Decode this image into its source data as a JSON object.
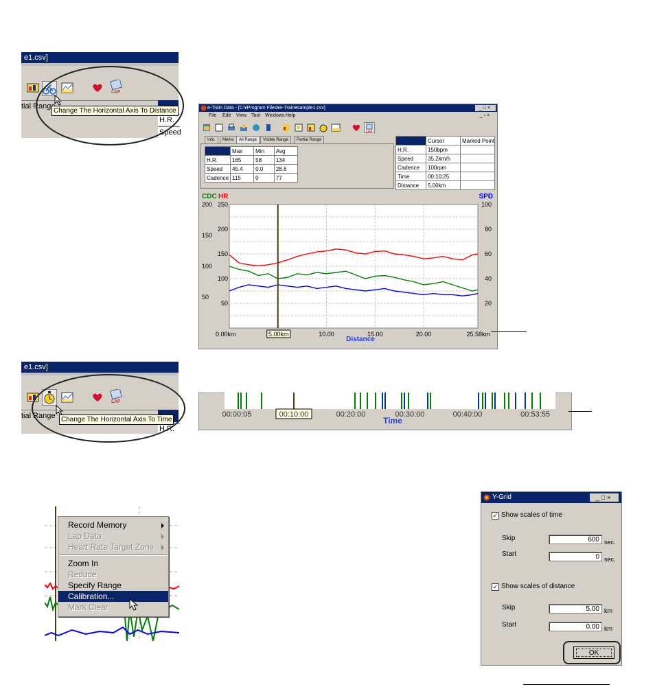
{
  "snip1": {
    "title_fragment": "e1.csv]",
    "tooltip": "Change The Horizontal Axis To Distance",
    "tab_fragment": "tial Range",
    "row_labels": [
      "H.R.",
      "Speed"
    ]
  },
  "snip2": {
    "title_fragment": "e1.csv]",
    "tooltip": "Change The Horizontal Axis To Time",
    "tab_fragment": "tial Range",
    "row_label": "H.R."
  },
  "main_window": {
    "title": "e-Train Data - [C:¥Program Files¥e-Train¥sample1.csv]",
    "menu": [
      "File",
      "Edit",
      "View",
      "Tool",
      "Windows",
      "Help"
    ],
    "tabs": [
      "Info.",
      "Memo",
      "All Range",
      "Visible Range",
      "Partial Range"
    ],
    "stats_headers": [
      "",
      "Max",
      "Min",
      "Avg"
    ],
    "stats_rows": [
      [
        "H.R.",
        "165",
        "58",
        "134"
      ],
      [
        "Speed",
        "45.4",
        "0.0",
        "28.6"
      ],
      [
        "Cadence",
        "115",
        "0",
        "77"
      ]
    ],
    "cursor_headers": [
      "",
      "Cursor",
      "Marked Point"
    ],
    "cursor_rows": [
      [
        "H.R.",
        "150bpm",
        ""
      ],
      [
        "Speed",
        "35.2km/h",
        ""
      ],
      [
        "Cadence",
        "100rpm",
        ""
      ],
      [
        "Time",
        "00:10:25",
        ""
      ],
      [
        "Distance",
        "5.00km",
        ""
      ]
    ]
  },
  "chart_data": {
    "type": "line",
    "xlabel": "Distance",
    "x_ticks": [
      "0.00km",
      "10.00",
      "15.00",
      "20.00",
      "25.58km"
    ],
    "cursor_label": "5.00km",
    "xlim": [
      0,
      25.58
    ],
    "legend": [
      {
        "label": "CDC",
        "color": "#008000"
      },
      {
        "label": "HR",
        "color": "#ff0000"
      },
      {
        "label": "SPD",
        "color": "#0000ff"
      }
    ],
    "axes": {
      "cdc": {
        "ticks": [
          "200",
          "150",
          "100",
          "50"
        ],
        "ylim": [
          0,
          200
        ]
      },
      "hr": {
        "ticks": [
          "250",
          "200",
          "150",
          "100",
          "50"
        ],
        "ylim": [
          0,
          250
        ]
      },
      "spd": {
        "ticks": [
          "100",
          "80",
          "60",
          "40",
          "20"
        ],
        "ylim": [
          0,
          100
        ]
      }
    },
    "grid": true,
    "cursor_x": 5.0,
    "series": [
      {
        "name": "HR",
        "color": "#ff0000",
        "x": [
          0,
          1,
          2,
          3,
          4,
          5,
          6,
          7,
          8,
          9,
          10,
          11,
          12,
          13,
          14,
          15,
          16,
          17,
          18,
          19,
          20,
          21,
          22,
          23,
          24,
          25,
          25.58
        ],
        "values": [
          148,
          132,
          128,
          126,
          128,
          132,
          138,
          145,
          150,
          154,
          156,
          160,
          158,
          152,
          150,
          155,
          156,
          150,
          148,
          145,
          140,
          142,
          145,
          140,
          138,
          148,
          150
        ]
      },
      {
        "name": "CDC",
        "color": "#008000",
        "x": [
          0,
          1,
          2,
          3,
          4,
          5,
          6,
          7,
          8,
          9,
          10,
          11,
          12,
          13,
          14,
          15,
          16,
          17,
          18,
          19,
          20,
          21,
          22,
          23,
          24,
          25,
          25.58
        ],
        "values": [
          100,
          95,
          92,
          85,
          88,
          80,
          82,
          88,
          86,
          90,
          88,
          90,
          92,
          86,
          80,
          84,
          85,
          82,
          78,
          75,
          70,
          72,
          75,
          70,
          65,
          60,
          62
        ]
      },
      {
        "name": "SPD",
        "color": "#0000ff",
        "x": [
          0,
          1,
          2,
          3,
          4,
          5,
          6,
          7,
          8,
          9,
          10,
          11,
          12,
          13,
          14,
          15,
          16,
          17,
          18,
          19,
          20,
          21,
          22,
          23,
          24,
          25,
          25.58
        ],
        "values": [
          30,
          33,
          35,
          34,
          33,
          35,
          34,
          33,
          34,
          32,
          33,
          34,
          32,
          31,
          30,
          31,
          32,
          30,
          29,
          28,
          27,
          28,
          27,
          27,
          26,
          27,
          28
        ]
      }
    ]
  },
  "time_axis": {
    "ticks": [
      "00:00:05",
      "00:10:00",
      "00:20:00",
      "00:30:00",
      "00:40:00",
      "00:53:55"
    ],
    "xlabel": "Time"
  },
  "context_menu": {
    "items": [
      {
        "label": "Record Memory",
        "disabled": false,
        "submenu": true
      },
      {
        "label": "Lap Data",
        "disabled": true,
        "submenu": true
      },
      {
        "label": "Heart Rate Target Zone",
        "disabled": true,
        "submenu": true
      },
      {
        "label": "Zoom In",
        "disabled": false,
        "submenu": false,
        "sep_before": true
      },
      {
        "label": "Reduce",
        "disabled": true,
        "submenu": false
      },
      {
        "label": "Specify Range",
        "disabled": false,
        "submenu": false
      },
      {
        "label": "Calibration...",
        "disabled": false,
        "submenu": false,
        "selected": true
      },
      {
        "label": "Mark Clear",
        "disabled": true,
        "submenu": false
      }
    ]
  },
  "ygrid_dialog": {
    "title": "Y-Grid",
    "time_checkbox": "Show scales of time",
    "time_skip_label": "Skip",
    "time_skip_value": "600",
    "time_unit": "sec.",
    "time_start_label": "Start",
    "time_start_value": "0",
    "distance_checkbox": "Show scales of distance",
    "dist_skip_label": "Skip",
    "dist_skip_value": "5.00",
    "dist_unit": "km",
    "dist_start_label": "Start",
    "dist_start_value": "0.00",
    "ok_label": "OK"
  }
}
